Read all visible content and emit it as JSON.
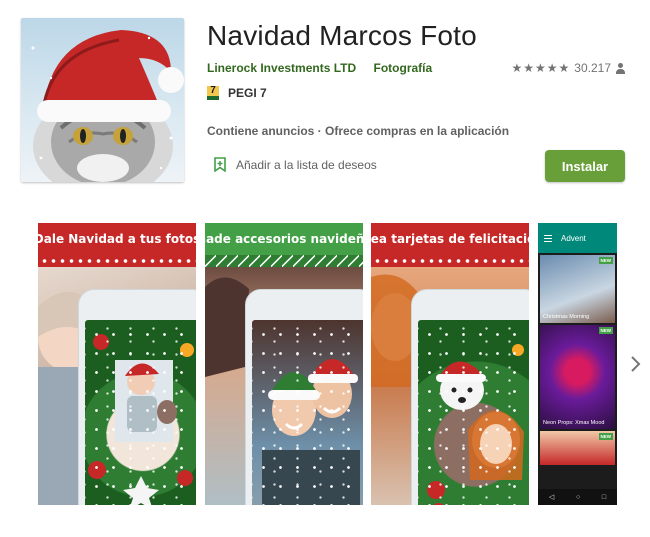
{
  "app": {
    "title": "Navidad Marcos Foto",
    "developer": "Linerock Investments LTD",
    "category": "Fotografía",
    "rating_stars": "★★★★★",
    "rating_count": "30.217",
    "pegi_badge": "7",
    "pegi_label": "PEGI 7",
    "ads_notice": "Contiene anuncios · Ofrece compras en la aplicación",
    "wishlist_label": "Añadir a la lista de deseos",
    "install_label": "Instalar"
  },
  "colors": {
    "link_green": "#33691e",
    "install_green": "#689f38",
    "banner_red": "#c62828",
    "banner_green": "#43a047",
    "advent_teal": "#00897b"
  },
  "screenshots": [
    {
      "banner": "Dale Navidad a tus fotos"
    },
    {
      "banner": "Añade accesorios navideños"
    },
    {
      "banner": "Crea tarjetas de felicitación"
    },
    {
      "header": "Advent",
      "cards": [
        {
          "label": "Christmas Morning",
          "badge": "NEW"
        },
        {
          "label": "Neon Props: Xmas Mood",
          "badge": "NEW"
        },
        {
          "label": "",
          "badge": "NEW"
        }
      ]
    }
  ],
  "icons": {
    "rating_user": "person-icon",
    "wishlist": "bookmark-add-icon",
    "next": "chevron-right-icon"
  }
}
